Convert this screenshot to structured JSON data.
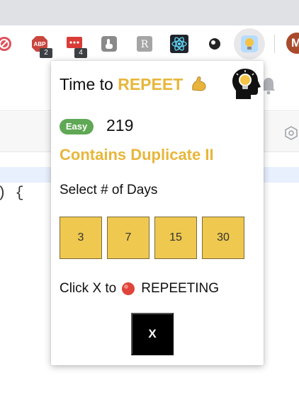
{
  "browser": {
    "extensions": [
      {
        "name": "blocker",
        "icon": "stop-sign-icon",
        "color": "#e0505a",
        "badge": ""
      },
      {
        "name": "abp",
        "icon": "adblock-icon",
        "color": "#c9463d",
        "badge": "2"
      },
      {
        "name": "chat",
        "icon": "chat-bubble-icon",
        "color": "#d93b36",
        "badge": "4"
      },
      {
        "name": "grey-hand",
        "icon": "hand-icon",
        "color": "#8a8a8a",
        "badge": ""
      },
      {
        "name": "grey-r",
        "icon": "letter-icon",
        "color": "#9a9a9a",
        "badge": ""
      },
      {
        "name": "react-devtools",
        "icon": "react-icon",
        "color": "#61dafb",
        "badge": ""
      },
      {
        "name": "eight-ball",
        "icon": "eight-ball-icon",
        "color": "#222222",
        "badge": ""
      },
      {
        "name": "repeet",
        "icon": "lightbulb-icon",
        "color": "#8fc7ff",
        "badge": ""
      }
    ],
    "profile_initial": "M",
    "profile_color": "#a94a2d"
  },
  "page": {
    "code_fragment": ") {"
  },
  "popup": {
    "title_prefix": "Time to",
    "brand": "REPEET",
    "title_icon": "flexed-biceps-icon",
    "logo_icon": "head-lightbulb-icon",
    "difficulty": "Easy",
    "problem_number": "219",
    "problem_title": "Contains Duplicate II",
    "days_label": "Select # of Days",
    "day_options": [
      "3",
      "7",
      "15",
      "30"
    ],
    "stop_prefix": "Click X to",
    "stop_icon": "red-circle-icon",
    "stop_suffix": "REPEETING",
    "stop_button_label": "X"
  },
  "colors": {
    "brand": "#e8b63a",
    "easy": "#5fa855",
    "day_button": "#efc84f",
    "stop_button": "#000000"
  }
}
